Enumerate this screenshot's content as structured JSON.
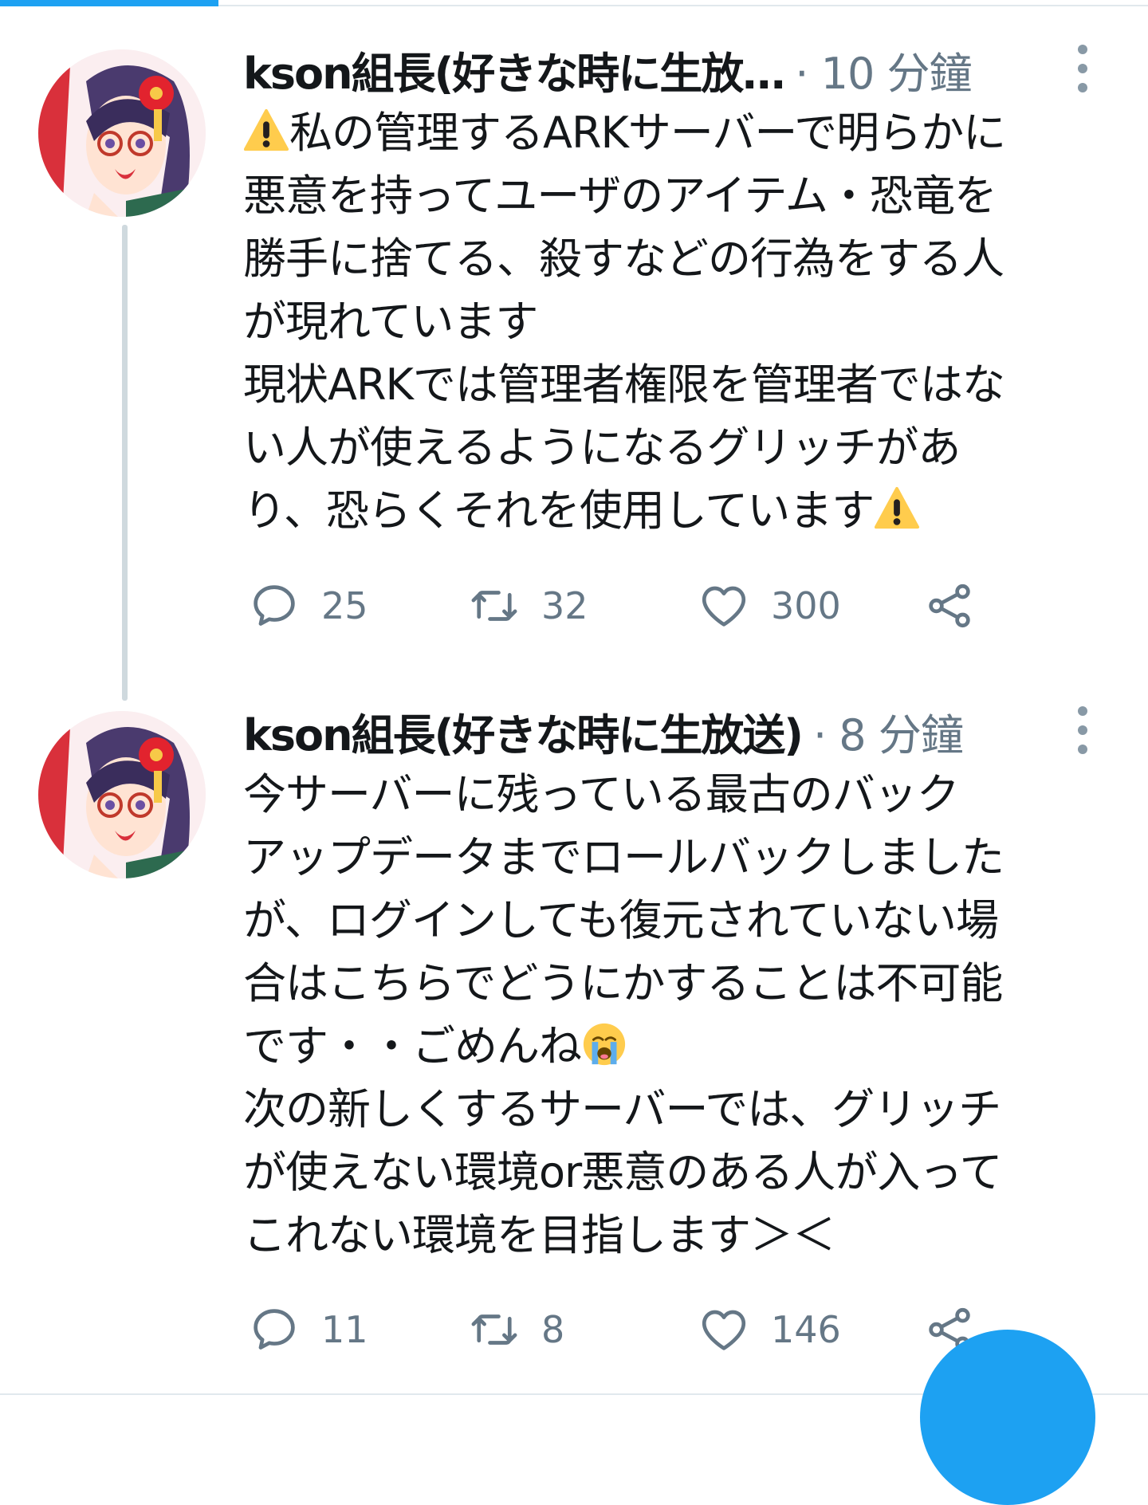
{
  "colors": {
    "accent": "#1da1f2",
    "icon_gray": "#657786",
    "text": "#14171a",
    "thread_line": "#cfd9de"
  },
  "progress": {
    "fraction": 0.19
  },
  "tweets": [
    {
      "author": "kson組長(好きな時に生放送)",
      "author_display": "kson組長(好きな時に生放…",
      "time": "· 10 分鐘",
      "body_lines": [
        "私の管理するARKサーバーで明らかに",
        "悪意を持ってユーザのアイテム・恐竜を",
        "勝手に捨てる、殺すなどの行為をする人",
        "が現れています",
        "現状ARKでは管理者権限を管理者ではな",
        "い人が使えるようになるグリッチがあ",
        "り、恐らくそれを使用しています"
      ],
      "emoji_lead": "warning-emoji",
      "emoji_trail": "warning-emoji",
      "replies": "25",
      "retweets": "32",
      "likes": "300"
    },
    {
      "author": "kson組長(好きな時に生放送)",
      "author_display": "kson組長(好きな時に生放送)",
      "time": "· 8 分鐘",
      "body_lines": [
        "今サーバーに残っている最古のバック",
        "アップデータまでロールバックしました",
        "が、ログインしても復元されていない場",
        "合はこちらでどうにかすることは不可能",
        "です・・ごめんね",
        "次の新しくするサーバーでは、グリッチ",
        "が使えない環境or悪意のある人が入って",
        "これない環境を目指します＞＜"
      ],
      "emoji_after_line_5": "loudly-crying-face-emoji",
      "replies": "11",
      "retweets": "8",
      "likes": "146"
    }
  ],
  "icons": {
    "reply": "speech-bubble-icon",
    "retweet": "retweet-arrows-icon",
    "like": "heart-outline-icon",
    "share": "share-nodes-icon",
    "more": "vertical-ellipsis-icon",
    "fab": "compose-tweet-button"
  }
}
